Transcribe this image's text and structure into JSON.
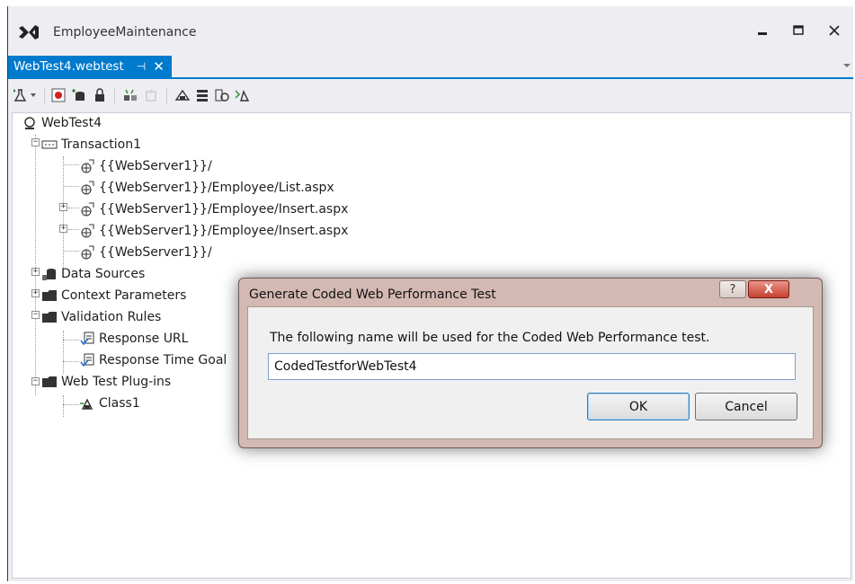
{
  "window": {
    "title": "EmployeeMaintenance"
  },
  "tab": {
    "label": "WebTest4.webtest",
    "pin": "⊣",
    "close": "✕"
  },
  "tree": {
    "root": "WebTest4",
    "transaction": "Transaction1",
    "requests": [
      "{{WebServer1}}/",
      "{{WebServer1}}/Employee/List.aspx",
      "{{WebServer1}}/Employee/Insert.aspx",
      "{{WebServer1}}/Employee/Insert.aspx",
      "{{WebServer1}}/"
    ],
    "data_sources": "Data Sources",
    "context_parameters": "Context Parameters",
    "validation_rules": "Validation Rules",
    "rules": [
      "Response URL",
      "Response Time Goal"
    ],
    "plugins": "Web Test Plug-ins",
    "plugin_items": [
      "Class1"
    ]
  },
  "dialog": {
    "title": "Generate Coded Web Performance Test",
    "help": "?",
    "close": "X",
    "prompt": "The following name will be used for the Coded Web Performance test.",
    "name_value": "CodedTestforWebTest4",
    "ok": "OK",
    "cancel": "Cancel"
  },
  "colors": {
    "accent": "#007acc",
    "dialog_frame": "#d3b9b1",
    "close_red": "#c6402f"
  }
}
